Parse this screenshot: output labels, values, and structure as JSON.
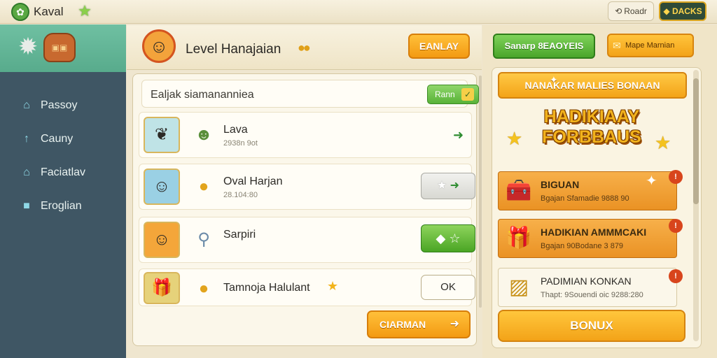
{
  "topbar": {
    "logo_icon": "leaf-icon",
    "title": "Kaval",
    "back_label": "Roadr",
    "coin_label": "DACKS"
  },
  "sidebar": {
    "items": [
      {
        "label": "Passoy",
        "icon": "home-icon"
      },
      {
        "label": "Cauny",
        "icon": "arrow-up-icon"
      },
      {
        "label": "Faciatlav",
        "icon": "house-outline-icon"
      },
      {
        "label": "Eroglian",
        "icon": "cube-icon"
      }
    ]
  },
  "center": {
    "level_title": "Level Hanajaian",
    "header_button": "EANLAY",
    "search_text": "Ealjak siamananniea",
    "search_button": "Rann",
    "rows": [
      {
        "title": "Lava",
        "sub": "2938n 9ot"
      },
      {
        "title": "Oval Harjan",
        "sub": "28.104:80"
      },
      {
        "title": "Sarpiri",
        "sub": ""
      },
      {
        "title": "Tamnoja Halulant",
        "sub": ""
      }
    ],
    "ok_label": "OK",
    "bottom_button": "CIARMAN"
  },
  "right": {
    "green_button": "Sanarp 8EAOYEIS",
    "orange_button": "Mape Marnian",
    "banner": "NANAKAR MALIES BONAAN",
    "hero_line1": "HADIKIAAY",
    "hero_line2": "FORBBAUS",
    "rewards": [
      {
        "title": "BIGUAN",
        "sub": "Bgajan Sfamadie 9888 90",
        "badge": "!"
      },
      {
        "title": "HADIKIAN AMMMCAKI",
        "sub": "Bgajan 90Bodane 3 879",
        "badge": "!"
      },
      {
        "title": "PADIMIAN KONKAN",
        "sub": "Thapt: 9Souendi oic 9288:280",
        "badge": "!"
      }
    ],
    "bonus_button": "BONUX"
  },
  "colors": {
    "sidebar": "#3f5664",
    "accent_orange": "#f39a12",
    "accent_green": "#4aa524",
    "panel_bg": "#fbf7ea"
  }
}
